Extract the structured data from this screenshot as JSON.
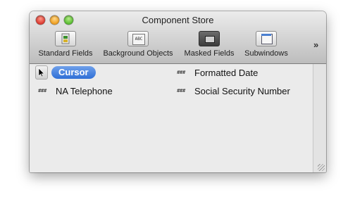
{
  "window": {
    "title": "Component Store"
  },
  "toolbar": {
    "items": [
      {
        "label": "Standard Fields",
        "icon": "standard-fields-icon"
      },
      {
        "label": "Background Objects",
        "icon": "background-objects-icon",
        "glyph": "ABC"
      },
      {
        "label": "Masked Fields",
        "icon": "masked-fields-icon",
        "selected": true
      },
      {
        "label": "Subwindows",
        "icon": "subwindows-icon"
      }
    ],
    "overflow_glyph": "»"
  },
  "components": {
    "cursor": {
      "label": "Cursor"
    },
    "formatted_date": {
      "label": "Formatted Date",
      "glyph": "###"
    },
    "na_telephone": {
      "label": "NA Telephone",
      "glyph": "###"
    },
    "ssn": {
      "label": "Social Security Number",
      "glyph": "###"
    }
  },
  "colors": {
    "accent": "#3a78dc",
    "close": "#e0443a",
    "minimize": "#f1a52b",
    "zoom": "#62c23a"
  }
}
